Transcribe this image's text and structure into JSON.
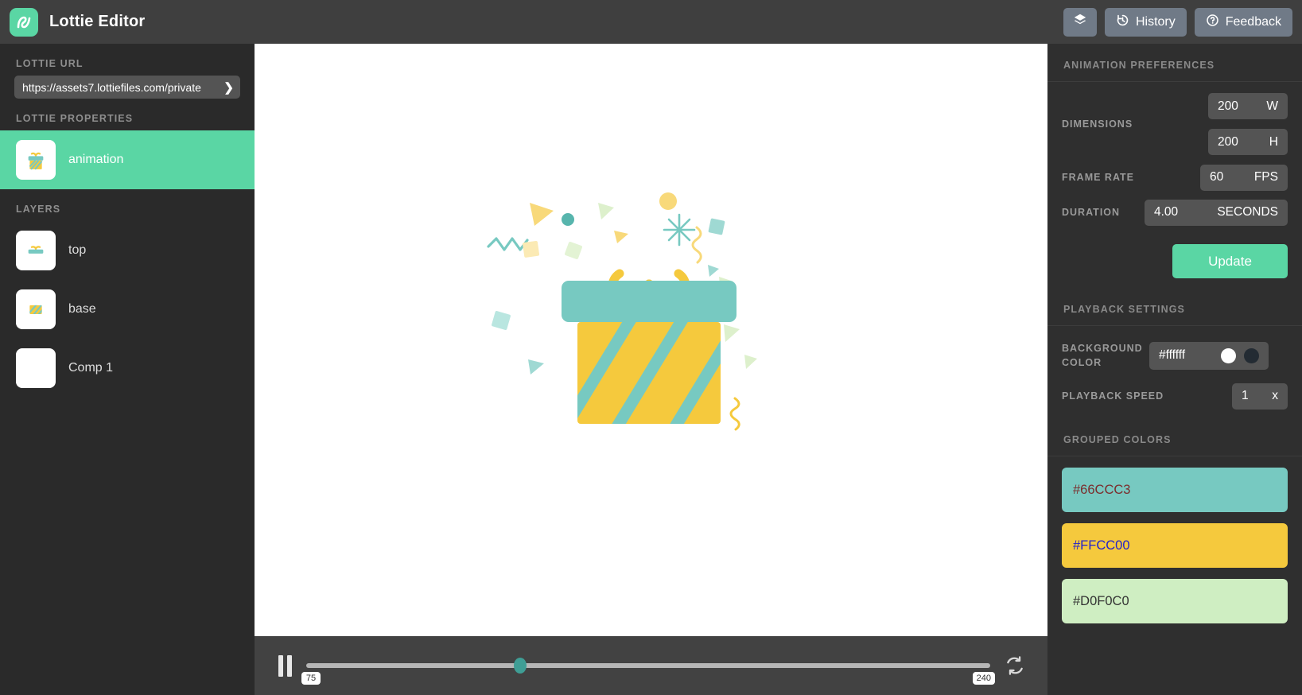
{
  "app": {
    "title": "Lottie Editor",
    "logo_icon": "lottie-curve-logo",
    "accent": "#5ad6a4"
  },
  "toolbar": {
    "layers_button": {
      "icon": "layers-icon",
      "label": ""
    },
    "history_button": {
      "icon": "clock-history-icon",
      "label": "History"
    },
    "feedback_button": {
      "icon": "question-circle-icon",
      "label": "Feedback"
    }
  },
  "sidebar": {
    "url_section_label": "LOTTIE URL",
    "url_value": "https://assets7.lottiefiles.com/private",
    "url_arrow_icon": "chevron-right-icon",
    "properties_label": "LOTTIE PROPERTIES",
    "properties": [
      {
        "label": "animation",
        "thumbnail": "gift-box-icon",
        "selected": true
      }
    ],
    "layers_label": "LAYERS",
    "layers": [
      {
        "label": "top",
        "thumbnail": "gift-lid-icon"
      },
      {
        "label": "base",
        "thumbnail": "gift-base-icon"
      },
      {
        "label": "Comp 1",
        "thumbnail": "blank-icon"
      }
    ]
  },
  "canvas": {
    "artwork": "gift-box-with-confetti",
    "background": "#ffffff"
  },
  "player": {
    "play_state_icon": "pause-icon",
    "loop_icon": "loop-icon",
    "current_frame": "75",
    "total_frames": "240",
    "progress_percent": 31.3
  },
  "preferences": {
    "section_label": "ANIMATION PREFERENCES",
    "dimensions_label": "DIMENSIONS",
    "width_value": "200",
    "width_unit": "W",
    "height_value": "200",
    "height_unit": "H",
    "frame_rate_label": "FRAME RATE",
    "frame_rate_value": "60",
    "frame_rate_unit": "FPS",
    "duration_label": "DURATION",
    "duration_value": "4.00",
    "duration_unit": "SECONDS",
    "update_label": "Update"
  },
  "playback": {
    "section_label": "PLAYBACK SETTINGS",
    "background_color_label": "BACKGROUND COLOR",
    "background_color_value": "#ffffff",
    "swatch_light": "#ffffff",
    "swatch_dark": "#232b33",
    "speed_label": "PLAYBACK SPEED",
    "speed_value": "1",
    "speed_unit": "x"
  },
  "grouped_colors": {
    "section_label": "GROUPED COLORS",
    "items": [
      {
        "hex": "#66CCC3",
        "bg": "#77c9c1",
        "text_color": "#7b2d2d"
      },
      {
        "hex": "#FFCC00",
        "bg": "#f5c93d",
        "text_color": "#2222cc"
      },
      {
        "hex": "#D0F0C0",
        "bg": "#cfeec2",
        "text_color": "#333333"
      }
    ]
  }
}
